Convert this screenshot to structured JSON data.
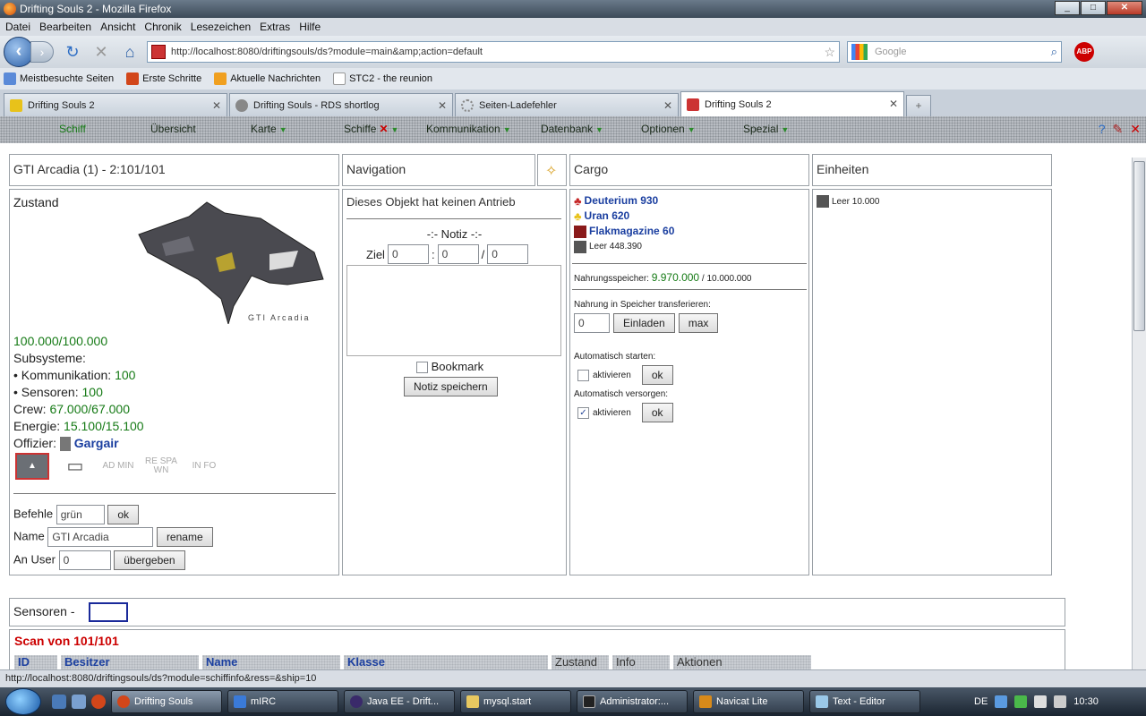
{
  "window": {
    "title": "Drifting Souls 2 - Mozilla Firefox",
    "min": "_",
    "max": "□",
    "close": "✕"
  },
  "menubar": [
    "Datei",
    "Bearbeiten",
    "Ansicht",
    "Chronik",
    "Lesezeichen",
    "Extras",
    "Hilfe"
  ],
  "navbar": {
    "url": "http://localhost:8080/driftingsouls/ds?module=main&amp;action=default",
    "search_placeholder": "Google",
    "abp": "ABP"
  },
  "bookmarks": [
    "Meistbesuchte Seiten",
    "Erste Schritte",
    "Aktuelle Nachrichten",
    "STC2 - the reunion"
  ],
  "tabs": [
    {
      "label": "Drifting Souls 2"
    },
    {
      "label": "Drifting Souls - RDS shortlog"
    },
    {
      "label": "Seiten-Ladefehler"
    },
    {
      "label": "Drifting Souls 2"
    }
  ],
  "gamemenu": {
    "items": [
      "Schiff",
      "Übersicht",
      "Karte",
      "Schiffe",
      "Kommunikation",
      "Datenbank",
      "Optionen",
      "Spezial"
    ],
    "tool_icons": [
      "help-icon",
      "edit-icon",
      "exit-icon"
    ]
  },
  "ship": {
    "title": "GTI Arcadia (1) - 2:101/101",
    "zustand_label": "Zustand",
    "image_caption": "GTI Arcadia",
    "hull": "100.000/100.000",
    "subsysteme_label": "Subsysteme:",
    "komm_label": "• Kommunikation:",
    "komm_value": "100",
    "sens_label": "• Sensoren:",
    "sens_value": "100",
    "crew_label": "Crew:",
    "crew_value": "67.000/67.000",
    "energie_label": "Energie:",
    "energie_value": "15.100/15.100",
    "offizier_label": "Offizier:",
    "offizier_name": "Gargair",
    "mode_icons": [
      "AD MIN",
      "RE SPA WN",
      "IN FO"
    ],
    "befehle_label": "Befehle",
    "befehle_value": "grün",
    "ok": "ok",
    "name_label": "Name",
    "name_value": "GTI Arcadia",
    "rename": "rename",
    "anuser_label": "An User",
    "anuser_value": "0",
    "uebergeben": "übergeben"
  },
  "navigation": {
    "title": "Navigation",
    "no_drive": "Dieses Objekt hat keinen Antrieb",
    "notiz_title": "-:- Notiz -:-",
    "ziel_label": "Ziel",
    "ziel_x": "0",
    "ziel_sep": ":",
    "ziel_y": "0",
    "ziel_slash": "/",
    "ziel_z": "0",
    "bookmark": "Bookmark",
    "save": "Notiz speichern"
  },
  "cargo": {
    "title": "Cargo",
    "items": [
      {
        "name": "Deuterium 930",
        "color": "#c62828"
      },
      {
        "name": "Uran 620",
        "color": "#e8c21a"
      },
      {
        "name": "Flakmagazine 60",
        "color": "#8a1a1a"
      }
    ],
    "leer": "Leer 448.390",
    "nahrung_label": "Nahrungsspeicher:",
    "nahrung_value": "9.970.000",
    "nahrung_max": "/ 10.000.000",
    "transfer_label": "Nahrung in Speicher transferieren:",
    "transfer_value": "0",
    "einladen": "Einladen",
    "max": "max",
    "auto_start_label": "Automatisch starten:",
    "auto_start_chk": "aktivieren",
    "auto_versorgen_label": "Automatisch versorgen:",
    "auto_versorgen_chk": "aktivieren",
    "ok": "ok"
  },
  "einheiten": {
    "title": "Einheiten",
    "leer": "Leer 10.000"
  },
  "sensoren": {
    "title": "Sensoren",
    "sep": "-",
    "scan_title": "Scan von 101/101",
    "columns": [
      "ID",
      "Besitzer",
      "Name",
      "Klasse",
      "Zustand",
      "Info",
      "Aktionen"
    ]
  },
  "statusbar": "http://localhost:8080/driftingsouls/ds?module=schiffinfo&ress=&ship=10",
  "taskbar": {
    "tasks": [
      "Drifting Souls",
      "mIRC",
      "Java EE - Drift...",
      "mysql.start",
      "Administrator:...",
      "Navicat Lite",
      "Text - Editor"
    ],
    "lang": "DE",
    "clock": "10:30"
  }
}
